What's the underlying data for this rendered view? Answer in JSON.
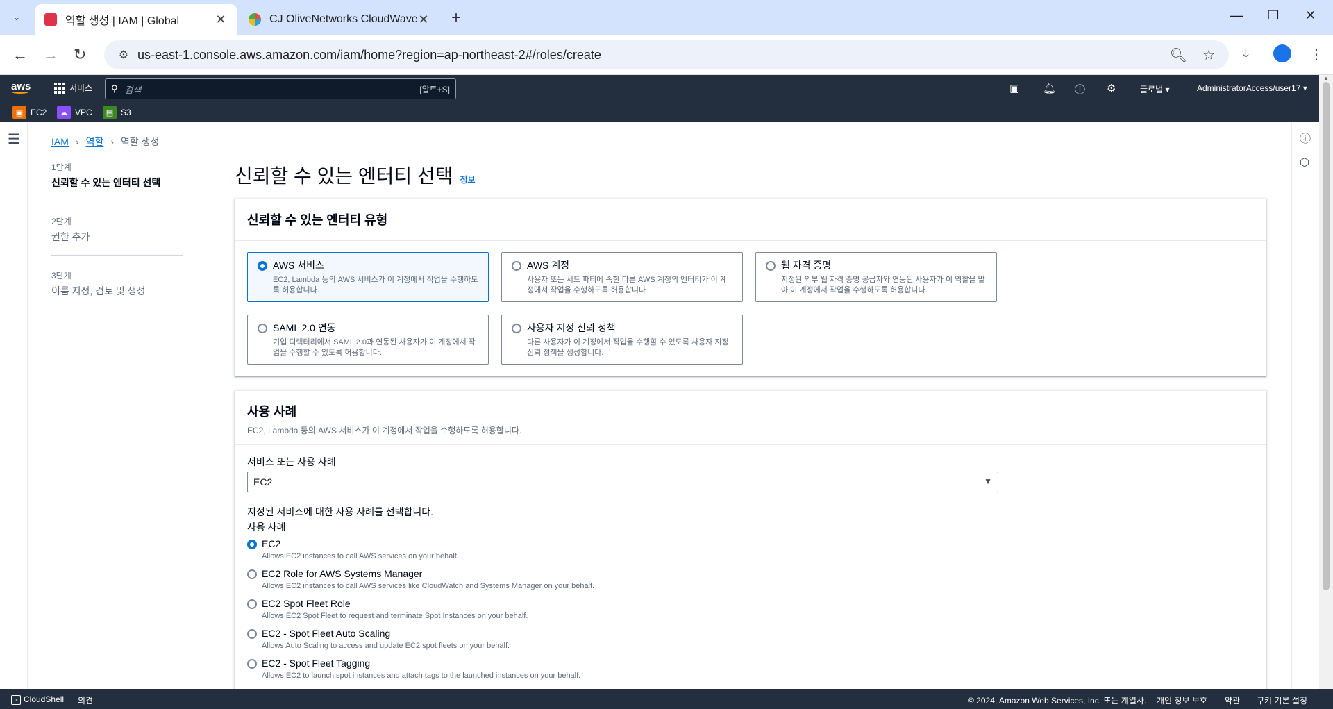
{
  "browser": {
    "tabs": [
      {
        "title": "역할 생성 | IAM | Global",
        "favicon_color": "#dd344c"
      },
      {
        "title": "CJ OliveNetworks CloudWave",
        "favicon_color": "#e84c3d"
      }
    ],
    "url": "us-east-1.console.aws.amazon.com/iam/home?region=ap-northeast-2#/roles/create"
  },
  "aws_nav": {
    "logo": "aws",
    "services_label": "서비스",
    "search_placeholder": "검색",
    "search_shortcut": "[알트+S]",
    "region": "글로벌 ▾",
    "account": "AdministratorAccess/user17 ▾",
    "favorites": [
      {
        "label": "EC2",
        "color": "#ed7100"
      },
      {
        "label": "VPC",
        "color": "#8c4fff"
      },
      {
        "label": "S3",
        "color": "#3f8624"
      }
    ]
  },
  "breadcrumb": {
    "root": "IAM",
    "mid": "역할",
    "current": "역할 생성"
  },
  "steps": [
    {
      "num": "1단계",
      "name": "신뢰할 수 있는 엔터티 선택"
    },
    {
      "num": "2단계",
      "name": "권한 추가"
    },
    {
      "num": "3단계",
      "name": "이름 지정, 검토 및 생성"
    }
  ],
  "page": {
    "title": "신뢰할 수 있는 엔터티 선택",
    "info": "정보"
  },
  "entity_section": {
    "title": "신뢰할 수 있는 엔터티 유형",
    "tiles": [
      {
        "title": "AWS 서비스",
        "desc": "EC2, Lambda 등의 AWS 서비스가 이 계정에서 작업을 수행하도록 허용합니다."
      },
      {
        "title": "AWS 계정",
        "desc": "사용자 또는 서드 파티에 속한 다른 AWS 계정의 엔터티가 이 계정에서 작업을 수행하도록 허용합니다."
      },
      {
        "title": "웹 자격 증명",
        "desc": "지정된 외부 웹 자격 증명 공급자와 연동된 사용자가 이 역할을 맡아 이 계정에서 작업을 수행하도록 허용합니다."
      },
      {
        "title": "SAML 2.0 연동",
        "desc": "기업 디렉터리에서 SAML 2.0과 연동된 사용자가 이 계정에서 작업을 수행할 수 있도록 허용합니다."
      },
      {
        "title": "사용자 지정 신뢰 정책",
        "desc": "다른 사용자가 이 계정에서 작업을 수행할 수 있도록 사용자 지정 신뢰 정책을 생성합니다."
      }
    ]
  },
  "usecase_section": {
    "title": "사용 사례",
    "subtitle": "EC2, Lambda 등의 AWS 서비스가 이 계정에서 작업을 수행하도록 허용합니다.",
    "select_label": "서비스 또는 사용 사례",
    "select_value": "EC2",
    "hint": "지정된 서비스에 대한 사용 사례를 선택합니다.",
    "list_label": "사용 사례",
    "options": [
      {
        "title": "EC2",
        "desc": "Allows EC2 instances to call AWS services on your behalf."
      },
      {
        "title": "EC2 Role for AWS Systems Manager",
        "desc": "Allows EC2 instances to call AWS services like CloudWatch and Systems Manager on your behalf."
      },
      {
        "title": "EC2 Spot Fleet Role",
        "desc": "Allows EC2 Spot Fleet to request and terminate Spot Instances on your behalf."
      },
      {
        "title": "EC2 - Spot Fleet Auto Scaling",
        "desc": "Allows Auto Scaling to access and update EC2 spot fleets on your behalf."
      },
      {
        "title": "EC2 - Spot Fleet Tagging",
        "desc": "Allows EC2 to launch spot instances and attach tags to the launched instances on your behalf."
      }
    ]
  },
  "footer": {
    "cloudshell": "CloudShell",
    "feedback": "의견",
    "copyright": "© 2024, Amazon Web Services, Inc. 또는 계열사.",
    "privacy": "개인 정보 보호",
    "terms": "약관",
    "cookies": "쿠키 기본 설정"
  }
}
